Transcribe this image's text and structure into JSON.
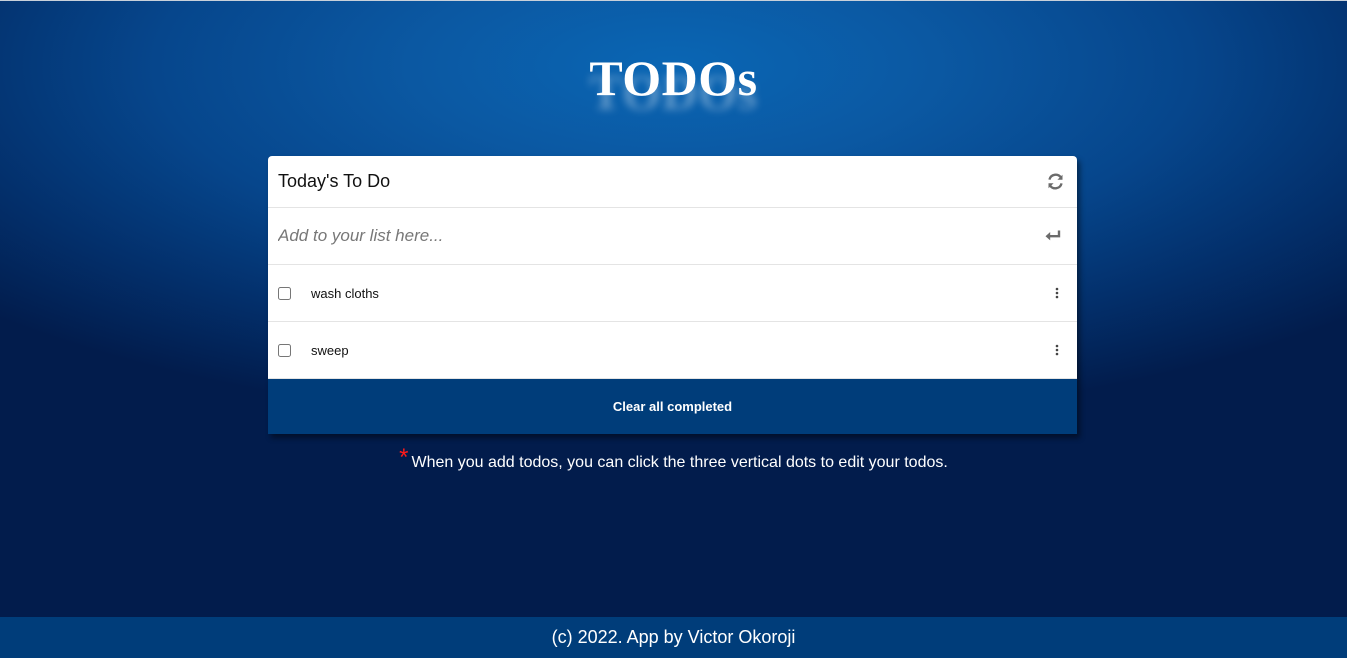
{
  "app": {
    "title": "TODOs"
  },
  "card": {
    "title": "Today's To Do",
    "refresh_icon": "refresh-icon",
    "add_input": {
      "placeholder": "Add to your list here...",
      "value": ""
    },
    "enter_icon": "enter-icon",
    "todos": [
      {
        "text": "wash cloths",
        "completed": false,
        "menu_icon": "vertical-dots-icon"
      },
      {
        "text": "sweep",
        "completed": false,
        "menu_icon": "vertical-dots-icon"
      }
    ],
    "clear_label": "Clear all completed"
  },
  "hint": {
    "marker": "*",
    "text": "When you add todos, you can click the three vertical dots to edit your todos."
  },
  "footer": {
    "text": "(c) 2022. App by Victor Okoroji"
  },
  "colors": {
    "accent": "#003d7a",
    "hint_marker": "#ff1a1a",
    "background": "#0a66b4"
  }
}
